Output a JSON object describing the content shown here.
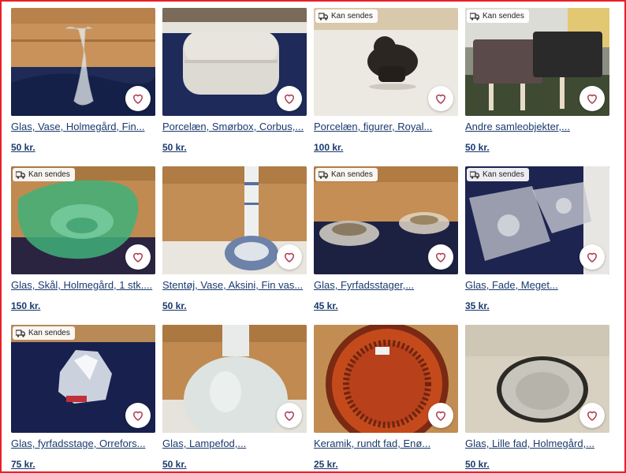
{
  "listings": [
    {
      "title": "Glas, Vase, Holmegård, Fin...",
      "price": "50 kr.",
      "ships": false
    },
    {
      "title": "Porcelæn, Smørbox, Corbus,...",
      "price": "50 kr.",
      "ships": false
    },
    {
      "title": "Porcelæn, figurer, Royal...",
      "price": "100 kr.",
      "ships": true
    },
    {
      "title": "Andre samleobjekter,...",
      "price": "50 kr.",
      "ships": true
    },
    {
      "title": "Glas, Skål, Holmegård, 1 stk....",
      "price": "150 kr.",
      "ships": true
    },
    {
      "title": "Stentøj, Vase, Aksini, Fin vas...",
      "price": "50 kr.",
      "ships": false
    },
    {
      "title": "Glas, Fyrfadsstager,...",
      "price": "45 kr.",
      "ships": true
    },
    {
      "title": "Glas, Fade, Meget...",
      "price": "35 kr.",
      "ships": true
    },
    {
      "title": "Glas, fyrfadsstage, Orrefors...",
      "price": "75 kr.",
      "ships": true
    },
    {
      "title": "Glas, Lampefod,...",
      "price": "50 kr.",
      "ships": false
    },
    {
      "title": "Keramik, rundt fad, Enø...",
      "price": "25 kr.",
      "ships": false
    },
    {
      "title": "Glas, Lille fad, Holmegård,...",
      "price": "50 kr.",
      "ships": false
    }
  ],
  "shipping_badge": "Kan sendes",
  "colors": {
    "link": "#1a3a6e",
    "heart": "#b03a4f",
    "frame": "#e8202a"
  },
  "icons": {
    "shipping": "truck-icon",
    "favorite": "heart-icon"
  }
}
